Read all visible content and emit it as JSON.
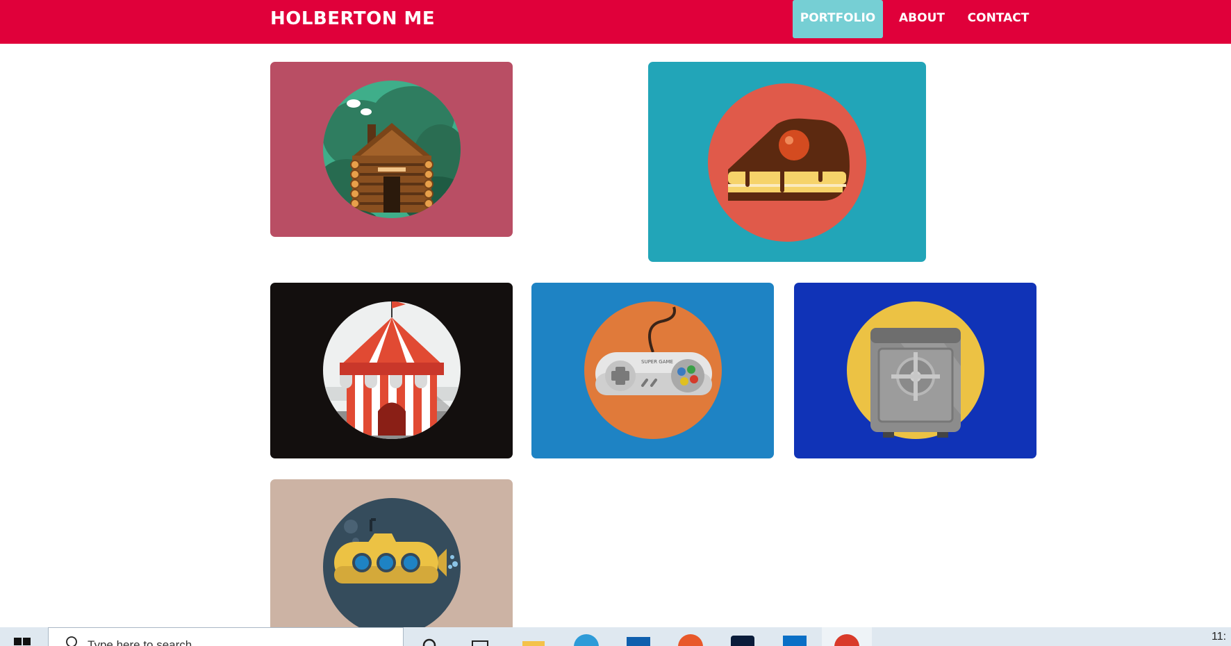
{
  "navbar": {
    "brand": "HOLBERTON ME",
    "links": [
      {
        "label": "PORTFOLIO",
        "active": true
      },
      {
        "label": "ABOUT",
        "active": false
      },
      {
        "label": "CONTACT",
        "active": false
      }
    ],
    "colors": {
      "background": "#e0003a",
      "active_background": "#76cfd4"
    }
  },
  "portfolio": {
    "items": [
      {
        "name": "log-cabin",
        "background": "#b94e64",
        "circle": "#3fae8a"
      },
      {
        "name": "cake-slice",
        "background": "#22a5b8",
        "circle": "#e05a4a"
      },
      {
        "name": "circus-tent",
        "background": "#130f0e",
        "circle": "#eef0f0"
      },
      {
        "name": "game-controller",
        "background": "#1e83c4",
        "circle": "#e07a3a"
      },
      {
        "name": "safe",
        "background": "#1033b7",
        "circle": "#ecc244"
      },
      {
        "name": "submarine",
        "background": "#ccb3a4",
        "circle": "#354c5c"
      }
    ],
    "controller_label": "SUPER GAME"
  },
  "taskbar": {
    "search_placeholder": "Type here to search",
    "clock": "11:",
    "icons": [
      "windows-start-icon",
      "search-icon",
      "task-view-icon",
      "file-explorer-icon",
      "edge-icon",
      "mail-icon",
      "firefox-icon",
      "photoshop-icon",
      "vscode-icon",
      "chrome-icon"
    ]
  }
}
